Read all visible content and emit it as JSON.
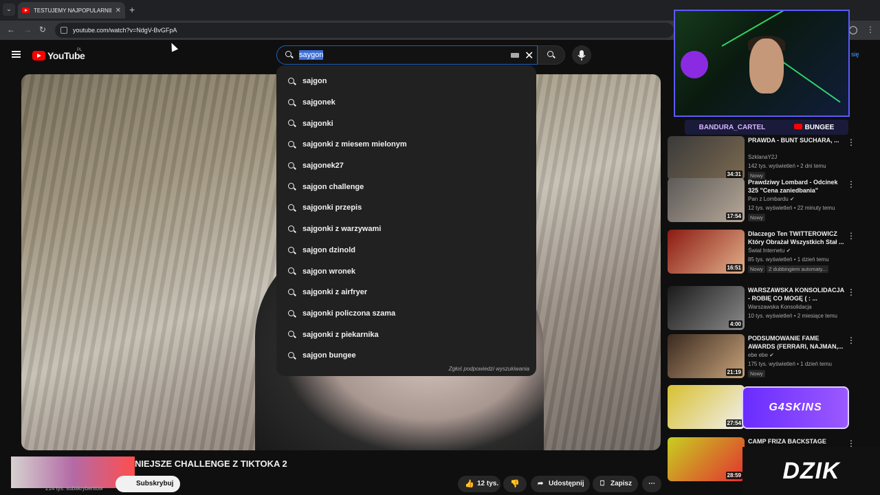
{
  "browser": {
    "tab_title": "TESTUJEMY NAJPOPULARNIEJS",
    "url": "youtube.com/watch?v=NdgV-BvGFpA"
  },
  "youtube": {
    "logo_text": "YouTube",
    "country": "PL",
    "search_value": "saygon",
    "signin_label": "się"
  },
  "suggestions": [
    "sajgon",
    "sajgonek",
    "sajgonki",
    "sajgonki z miesem mielonym",
    "sajgonek27",
    "sajgon challenge",
    "sajgonki przepis",
    "sajgonki z warzywami",
    "sajgon dzinold",
    "sajgon wronek",
    "sajgonki z airfryer",
    "sajgonki policzona szama",
    "sajgonki z piekarnika",
    "sajgon bungee"
  ],
  "report_label": "Zgłoś podpowiedzi wyszukiwania",
  "overlay": {
    "social_left": "BANDURA_CARTEL",
    "social_right": "BUNGEE",
    "sponsor1": "G4SKINS",
    "sponsor2": "DZIK"
  },
  "video": {
    "title": "NIEJSZE CHALLENGE Z TIKTOKA 2",
    "subscribers": "214 tys. subskrybentów",
    "subscribe_label": "Subskrybuj",
    "likes": "12 tys.",
    "share_label": "Udostępnij",
    "save_label": "Zapisz"
  },
  "recommendations": [
    {
      "title": "PRAWDA - BUNT SUCHARA, ...",
      "channel": "SzklanaY2J",
      "meta": "142 tys. wyświetleń • 2 dni temu",
      "badge": "Nowy",
      "duration": "34:31",
      "colors": [
        "#3a3a3a",
        "#7c6a50"
      ]
    },
    {
      "title": "Prawdziwy Lombard - Odcinek 325 \"Cena zaniedbania\"",
      "channel": "Pan z Lombardu ✔",
      "meta": "12 tys. wyświetleń • 22 minuty temu",
      "badge": "Nowy",
      "duration": "17:54",
      "colors": [
        "#5c5a58",
        "#b8a898"
      ]
    },
    {
      "title": "Dlaczego Ten TWITTEROWICZ Który Obrażał Wszystkich Stał ...",
      "channel": "Świat Internetu ✔",
      "meta": "85 tys. wyświetleń • 1 dzień temu",
      "badge": "Nowy",
      "badge2": "Z dubbingiem automaty...",
      "duration": "16:51",
      "colors": [
        "#8c1a12",
        "#e2b08a"
      ]
    },
    {
      "title": "WARSZAWSKA KONSOLIDACJA - ROBIĘ CO MOGĘ ( : ...",
      "channel": "Warszawska Konsolidacja",
      "meta": "10 tys. wyświetleń • 2 miesiące temu",
      "badge": "",
      "duration": "4:00",
      "colors": [
        "#1a1a1a",
        "#8a8a8a"
      ]
    },
    {
      "title": "PODSUMOWANIE FAME AWARDS (FERRARI, NAJMAN,...",
      "channel": "ebe ebe ✔",
      "meta": "175 tys. wyświetleń • 1 dzień temu",
      "badge": "Nowy",
      "duration": "21:19",
      "colors": [
        "#3a2a20",
        "#c7a27a"
      ]
    },
    {
      "title": "",
      "channel": "",
      "meta": "",
      "badge": "",
      "duration": "27:54",
      "colors": [
        "#d8c030",
        "#f0f0f0"
      ]
    },
    {
      "title": "CAMP FRIZA BACKSTAGE",
      "channel": "",
      "meta": "",
      "badge": "",
      "duration": "28:59",
      "colors": [
        "#c7d020",
        "#e23030"
      ]
    }
  ]
}
